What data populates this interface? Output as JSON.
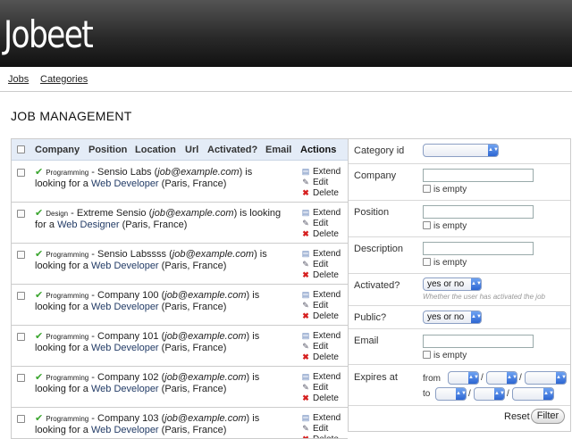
{
  "header": {
    "logo": "Jobeet"
  },
  "nav": {
    "jobs": "Jobs",
    "categories": "Categories"
  },
  "page": {
    "title": "JOB MANAGEMENT"
  },
  "list": {
    "columns": [
      "Company",
      "Position",
      "Location",
      "Url",
      "Activated?",
      "Email",
      "Actions"
    ],
    "rows": [
      {
        "category": "Programming",
        "company": "Sensio Labs",
        "email": "job@example.com",
        "line1_tail": " is",
        "line2_mid": "looking for a ",
        "position": "Web Developer",
        "location": "(Paris, France)"
      },
      {
        "category": "Design",
        "company": "Extreme Sensio",
        "email": "job@example.com",
        "line1_tail": " is looking",
        "line2_mid": "for a ",
        "position": "Web Designer",
        "location": "(Paris, France)"
      },
      {
        "category": "Programming",
        "company": "Sensio Labssss",
        "email": "job@example.com",
        "line1_tail": " is",
        "line2_mid": "looking for a ",
        "position": "Web Developer",
        "location": "(Paris, France)"
      },
      {
        "category": "Programming",
        "company": "Company 100",
        "email": "job@example.com",
        "line1_tail": " is",
        "line2_mid": "looking for a ",
        "position": "Web Developer",
        "location": "(Paris, France)"
      },
      {
        "category": "Programming",
        "company": "Company 101",
        "email": "job@example.com",
        "line1_tail": " is",
        "line2_mid": "looking for a ",
        "position": "Web Developer",
        "location": "(Paris, France)"
      },
      {
        "category": "Programming",
        "company": "Company 102",
        "email": "job@example.com",
        "line1_tail": " is",
        "line2_mid": "looking for a ",
        "position": "Web Developer",
        "location": "(Paris, France)"
      },
      {
        "category": "Programming",
        "company": "Company 103",
        "email": "job@example.com",
        "line1_tail": " is",
        "line2_mid": "looking for a ",
        "position": "Web Developer",
        "location": "(Paris, France)"
      }
    ],
    "actions": {
      "extend": "Extend",
      "edit": "Edit",
      "delete": "Delete"
    },
    "separator": " - ",
    "open_paren": " (",
    "close_paren": ")",
    "space": " "
  },
  "filters": {
    "category_id": "Category id",
    "company": "Company",
    "position": "Position",
    "description": "Description",
    "activated": "Activated?",
    "activated_value": "yes or no",
    "activated_hint": "Whether the user has activated the job",
    "public": "Public?",
    "public_value": "yes or no",
    "email": "Email",
    "expires_at": "Expires at",
    "from": "from",
    "to": "to",
    "date_sep": "/",
    "is_empty": "is empty",
    "reset": "Reset",
    "filter": "Filter"
  },
  "colors": {
    "header_dark": "#111111",
    "head_row": "#e4ecf7",
    "link": "#223b66",
    "select_arrow": "#2d66d2",
    "check": "#3aa52e",
    "delete": "#d62020"
  },
  "icons": {
    "active": "check-icon",
    "extend": "calendar-icon",
    "edit": "pencil-icon",
    "delete": "cross-icon",
    "dropdown": "chevron-updown-icon"
  }
}
